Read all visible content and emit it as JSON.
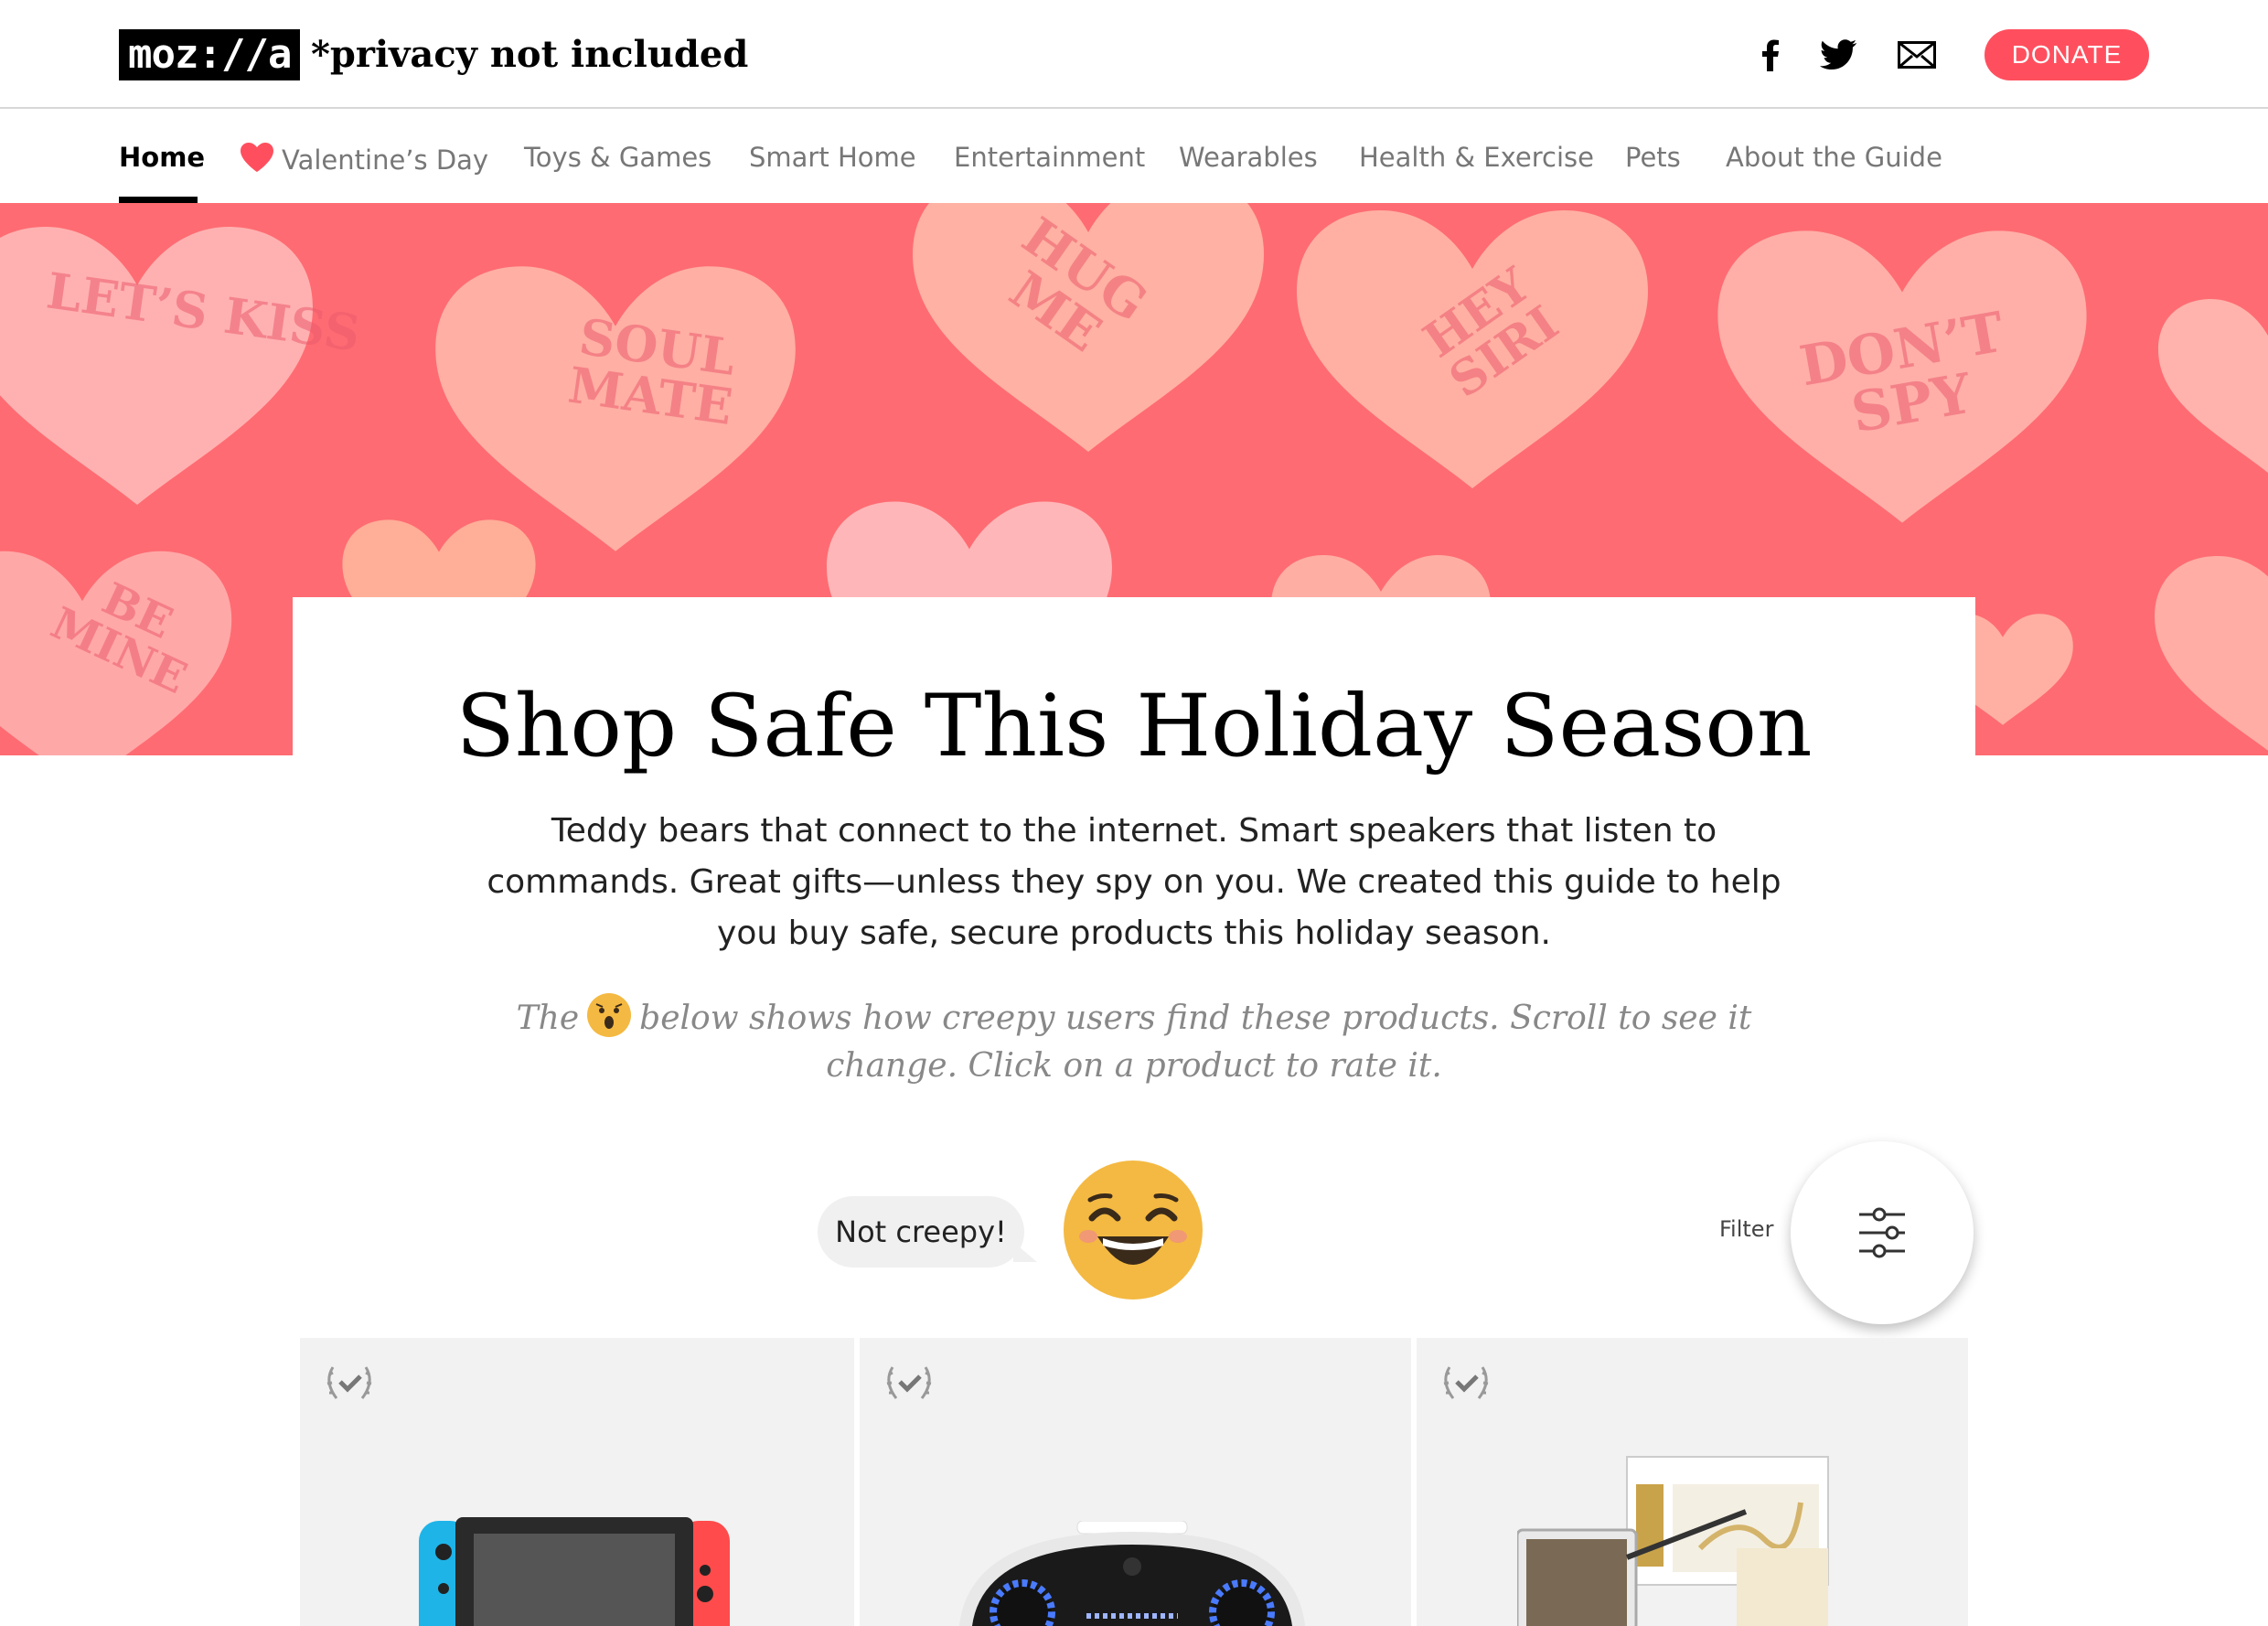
{
  "header": {
    "logo_text": "moz://a",
    "tagline": "*privacy not included",
    "social": [
      "facebook-icon",
      "twitter-icon",
      "email-icon"
    ],
    "donate_label": "DONATE"
  },
  "nav": {
    "items": [
      {
        "label": "Home",
        "active": true
      },
      {
        "label": "Valentine’s Day",
        "icon": "heart-icon"
      },
      {
        "label": "Toys & Games"
      },
      {
        "label": "Smart Home"
      },
      {
        "label": "Entertainment"
      },
      {
        "label": "Wearables"
      },
      {
        "label": "Health & Exercise"
      },
      {
        "label": "Pets"
      },
      {
        "label": "About the Guide"
      }
    ]
  },
  "hero": {
    "candies": [
      "LET’S KISS",
      "SOUL MATE",
      "HUG ME",
      "HEY SIRI",
      "DON’T SPY",
      "BE MINE"
    ]
  },
  "main": {
    "title": "Shop Safe This Holiday Season",
    "intro": "Teddy bears that connect to the internet. Smart speakers that listen to commands. Great gifts—unless they spy on you. We created this guide to help you buy safe, secure products this holiday season.",
    "note_prefix": "The",
    "note_suffix": "below shows how creepy users find these products. Scroll to see it change. Click on a product to rate it."
  },
  "creep_meter": {
    "label": "Not creepy!",
    "face_icon": "laughing-face-icon"
  },
  "filter": {
    "label": "Filter",
    "icon": "sliders-icon"
  },
  "products": [
    {
      "image": "game-console-image"
    },
    {
      "image": "robot-image"
    },
    {
      "image": "wand-kit-image"
    }
  ],
  "colors": {
    "accent": "#ff4f5e",
    "hero_bg": "#ff6b72",
    "candy": "#ffb1a3"
  }
}
